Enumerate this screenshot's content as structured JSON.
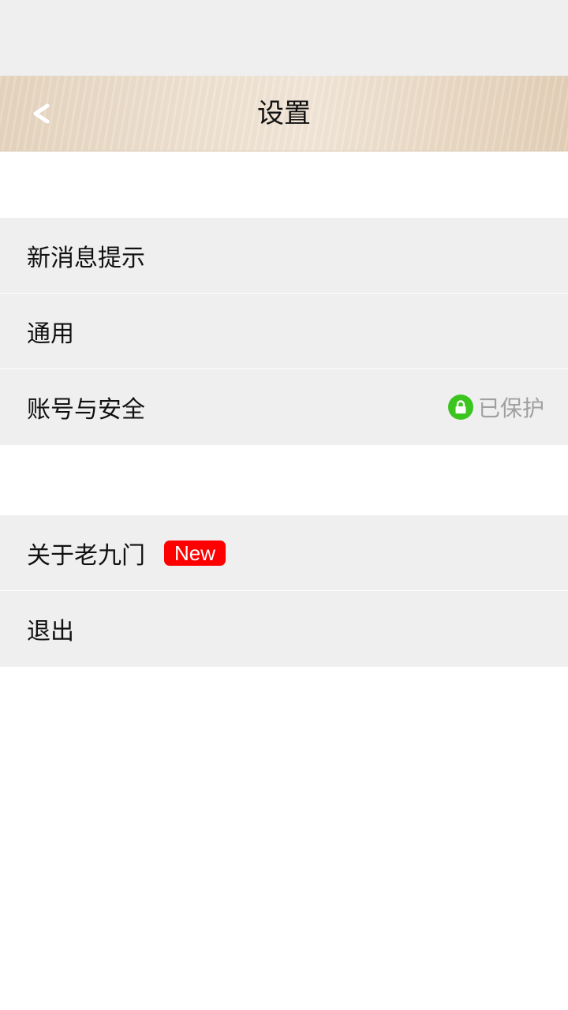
{
  "header": {
    "title": "设置",
    "back_icon": "chevron-left-icon"
  },
  "settings_group_1": {
    "items": [
      {
        "label": "新消息提示"
      },
      {
        "label": "通用"
      },
      {
        "label": "账号与安全",
        "status": "已保护",
        "status_icon": "lock-icon",
        "status_icon_color": "#3cc51f"
      }
    ]
  },
  "settings_group_2": {
    "items": [
      {
        "label": "关于老九门",
        "badge": "New",
        "badge_color": "#ff0000"
      },
      {
        "label": "退出"
      }
    ]
  }
}
